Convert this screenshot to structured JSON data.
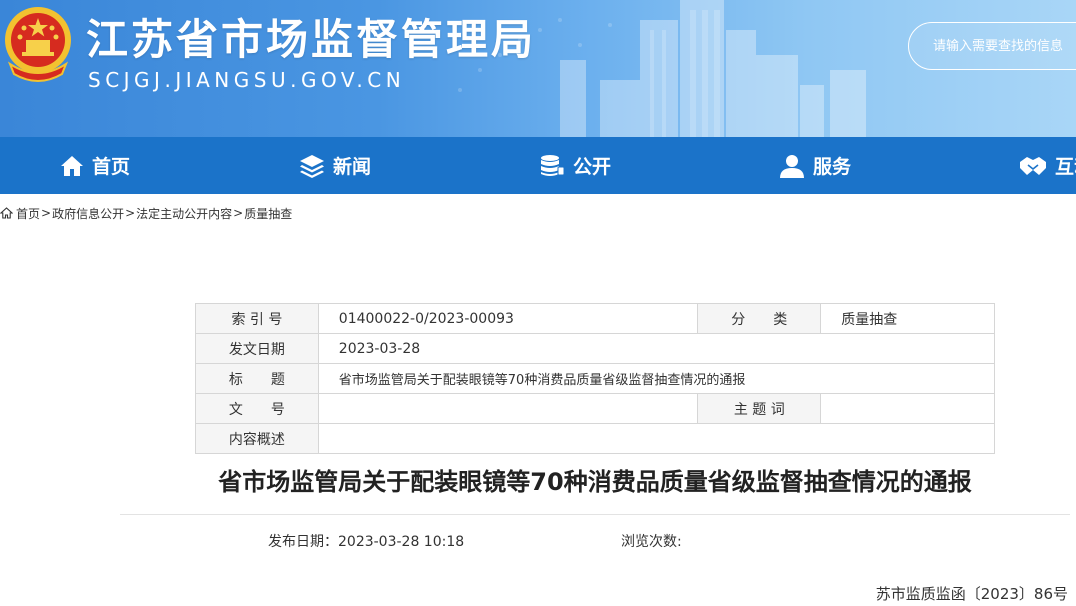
{
  "header": {
    "site_title": "江苏省市场监督管理局",
    "site_domain": "SCJGJ.JIANGSU.GOV.CN",
    "search_placeholder": "请输入需要查找的信息"
  },
  "nav": {
    "items": [
      {
        "label": "首页",
        "icon": "home-icon"
      },
      {
        "label": "新闻",
        "icon": "layers-icon"
      },
      {
        "label": "公开",
        "icon": "database-icon"
      },
      {
        "label": "服务",
        "icon": "user-icon"
      },
      {
        "label": "互动",
        "icon": "handshake-icon"
      }
    ]
  },
  "breadcrumb": {
    "items": [
      "首页",
      "政府信息公开",
      "法定主动公开内容",
      "质量抽查"
    ],
    "separator": ">"
  },
  "info": {
    "index_label": "索 引 号",
    "index_value": "01400022-0/2023-00093",
    "category_label": "分　　类",
    "category_value": "质量抽查",
    "date_label": "发文日期",
    "date_value": "2023-03-28",
    "title_label": "标　　题",
    "title_value": "省市场监管局关于配装眼镜等70种消费品质量省级监督抽查情况的通报",
    "docno_label": "文　　号",
    "docno_value": "",
    "subject_label": "主 题 词",
    "subject_value": "",
    "summary_label": "内容概述",
    "summary_value": ""
  },
  "article": {
    "title": "省市场监管局关于配装眼镜等70种消费品质量省级监督抽查情况的通报",
    "publish_date": "发布日期：2023-03-28 10:18",
    "views_label": "浏览次数:",
    "doc_number": "苏市监质监函〔2023〕86号"
  },
  "colors": {
    "nav_bg": "#1b73c9",
    "banner_left": "#3a86d8",
    "banner_right": "#a9d6f7"
  }
}
